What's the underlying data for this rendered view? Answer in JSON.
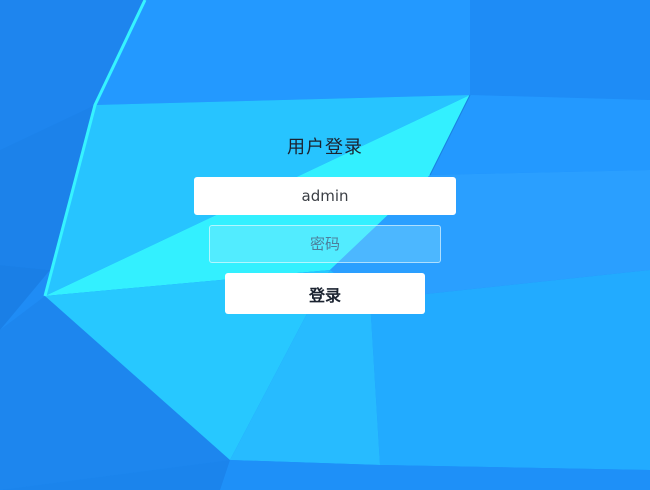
{
  "login": {
    "title": "用户登录",
    "username_value": "admin",
    "password_placeholder": "密码",
    "submit_label": "登录"
  },
  "colors": {
    "background_primary": "#1f8cf5",
    "background_cyan": "#34f0ff",
    "button_background": "#ffffff"
  }
}
